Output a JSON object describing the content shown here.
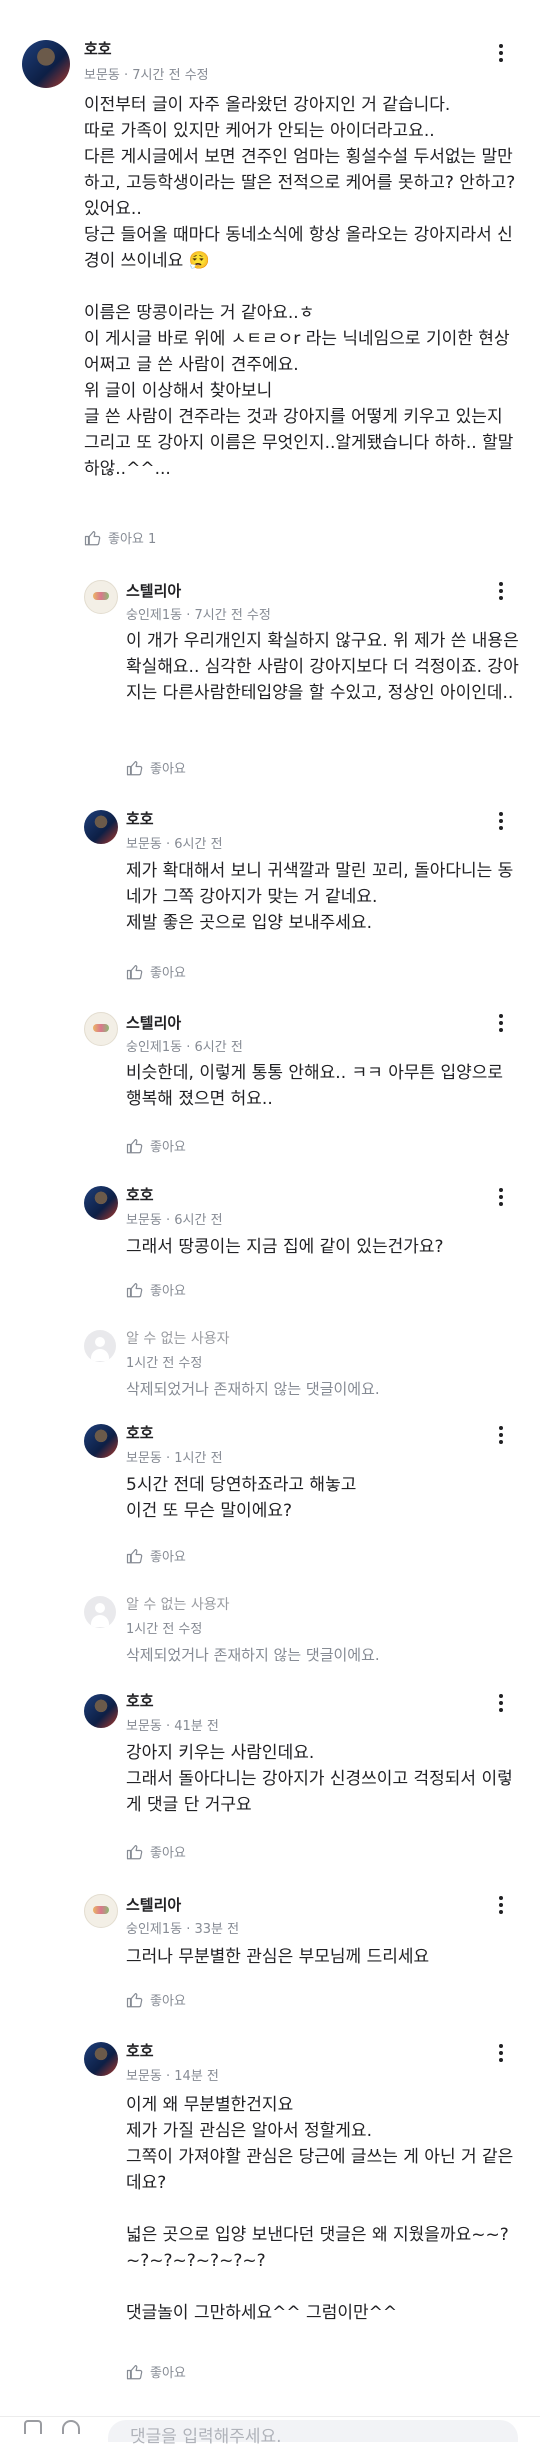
{
  "like_label": "좋아요",
  "comments": [
    {
      "author": "호호",
      "meta": "보문동 · 7시간 전 수정",
      "avatar": "hoho",
      "text": "이전부터 글이 자주 올라왔던 강아지인 거 같습니다.\n따로 가족이 있지만 케어가 안되는 아이더라고요..\n다른 게시글에서 보면 견주인 엄마는 횡설수설 두서없는 말만 하고, 고등학생이라는 딸은 전적으로 케어를 못하고? 안하고? 있어요..\n당근 들어올 때마다 동네소식에 항상 올라오는 강아지라서 신경이 쓰이네요 😮‍💨\n\n이름은 땅콩이라는 거 같아요..ㅎ\n이 게시글 바로 위에 ㅅㅌㄹㅇr 라는 닉네임으로 기이한 현상 어쩌고 글 쓴 사람이 견주에요.\n위 글이 이상해서 찾아보니\n글 쓴 사람이 견주라는 것과 강아지를 어떻게 키우고 있는지 그리고 또 강아지 이름은 무엇인지..알게됐습니다 하하.. 할말하않..^^...",
      "likes": "좋아요 1"
    },
    {
      "author": "스텔리아",
      "meta": "숭인제1동 · 7시간 전 수정",
      "avatar": "stella",
      "text": "이 개가 우리개인지 확실하지 않구요. 위 제가 쓴 내용은 확실해요.. 심각한 사람이 강아지보다 더 걱정이죠. 강아지는 다른사람한테입양을 할 수있고, 정상인 아이인데..",
      "likes": "좋아요"
    },
    {
      "author": "호호",
      "meta": "보문동 · 6시간 전",
      "avatar": "hoho",
      "text": "제가 확대해서 보니 귀색깔과 말린 꼬리, 돌아다니는 동네가 그쪽 강아지가 맞는 거 같네요.\n제발 좋은 곳으로 입양 보내주세요.",
      "likes": "좋아요"
    },
    {
      "author": "스텔리아",
      "meta": "숭인제1동 · 6시간 전",
      "avatar": "stella",
      "text": "비슷한데, 이렇게 통통 안해요.. ㅋㅋ 아무튼 입양으로 행복해 졌으면 허요..",
      "likes": "좋아요"
    },
    {
      "author": "호호",
      "meta": "보문동 · 6시간 전",
      "avatar": "hoho",
      "text": "그래서 땅콩이는 지금 집에 같이 있는건가요?",
      "likes": "좋아요"
    },
    {
      "author": "알 수 없는 사용자",
      "meta": "1시간 전 수정",
      "avatar": "unknown",
      "text": "삭제되었거나 존재하지 않는 댓글이에요.",
      "likes": ""
    },
    {
      "author": "호호",
      "meta": "보문동 · 1시간 전",
      "avatar": "hoho",
      "text": "5시간 전데 당연하죠라고 해놓고\n이건 또 무슨 말이에요?",
      "likes": "좋아요"
    },
    {
      "author": "알 수 없는 사용자",
      "meta": "1시간 전 수정",
      "avatar": "unknown",
      "text": "삭제되었거나 존재하지 않는 댓글이에요.",
      "likes": ""
    },
    {
      "author": "호호",
      "meta": "보문동 · 41분 전",
      "avatar": "hoho",
      "text": "강아지 키우는 사람인데요.\n그래서 돌아다니는 강아지가 신경쓰이고 걱정되서 이렇게 댓글 단 거구요",
      "likes": "좋아요"
    },
    {
      "author": "스텔리아",
      "meta": "숭인제1동 · 33분 전",
      "avatar": "stella",
      "text": "그러나 무분별한 관심은 부모님께 드리세요",
      "likes": "좋아요"
    },
    {
      "author": "호호",
      "meta": "보문동 · 14분 전",
      "avatar": "hoho",
      "text": "이게 왜 무분별한건지요\n제가 가질 관심은 알아서 정할게요.\n그쪽이 가져야할 관심은 당근에 글쓰는 게 아닌 거 같은데요?\n\n넓은 곳으로 입양 보낸다던 댓글은 왜 지웠을까요~~?~?~?~?~?~?~?\n\n댓글놀이 그만하세요^^ 그럼이만^^",
      "likes": "좋아요"
    }
  ],
  "input": {
    "placeholder": "댓글을 입력해주세요."
  },
  "icons": {
    "more": "more-vertical-icon",
    "like": "thumb-up-icon",
    "camera": "camera-icon",
    "at": "mention-icon"
  }
}
